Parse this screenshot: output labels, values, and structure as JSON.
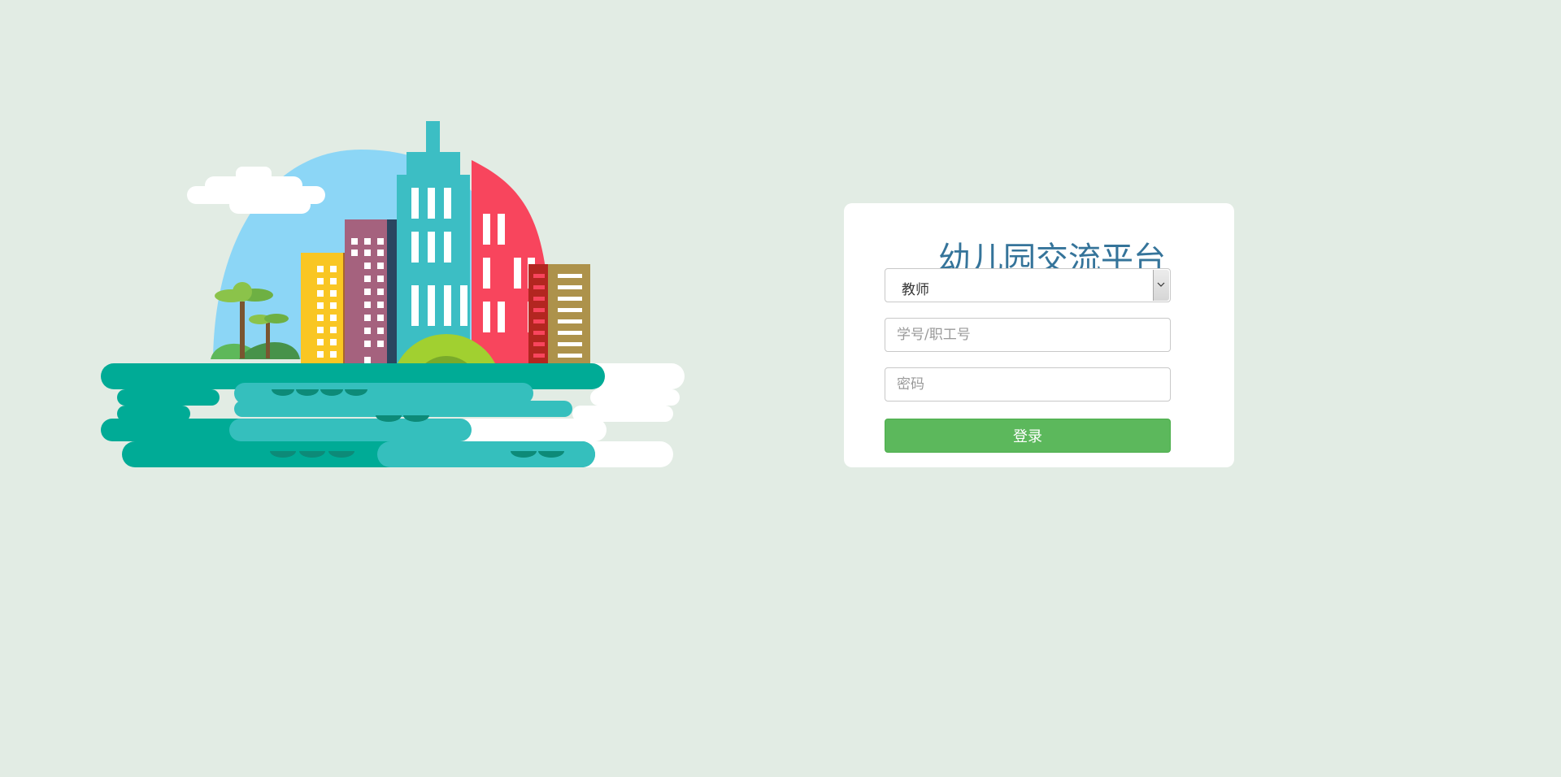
{
  "login": {
    "title": "幼儿园交流平台",
    "role_selected": "教师",
    "id_placeholder": "学号/职工号",
    "password_placeholder": "密码",
    "submit_label": "登录"
  },
  "colors": {
    "background": "#e2ece4",
    "title": "#35749a",
    "button": "#5cb85c"
  },
  "icons": {
    "select_arrow": "chevron-down-icon"
  }
}
